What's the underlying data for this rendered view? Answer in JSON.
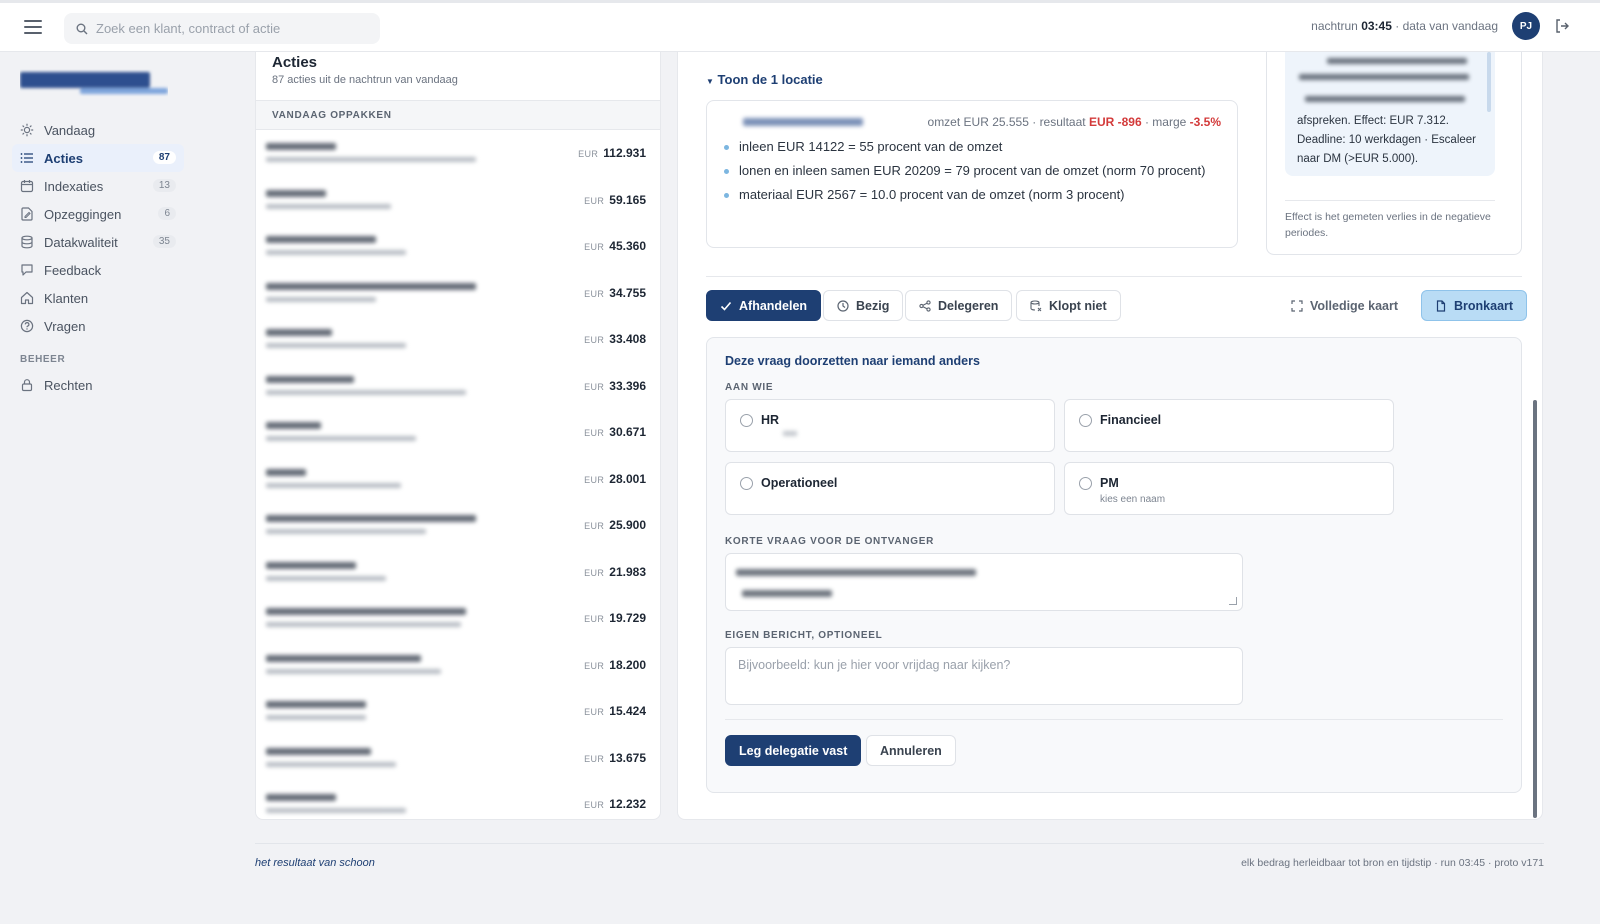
{
  "topbar": {
    "search_placeholder": "Zoek een klant, contract of actie",
    "run_prefix": "nachtrun",
    "run_time": "03:45",
    "run_suffix": "· data van vandaag",
    "avatar_initials": "PJ"
  },
  "sidebar": {
    "items": [
      {
        "label": "Vandaag",
        "icon": "sun-icon",
        "badge": ""
      },
      {
        "label": "Acties",
        "icon": "list-icon",
        "badge": "87"
      },
      {
        "label": "Indexaties",
        "icon": "calendar-icon",
        "badge": "13"
      },
      {
        "label": "Opzeggingen",
        "icon": "document-edit-icon",
        "badge": "6"
      },
      {
        "label": "Datakwaliteit",
        "icon": "database-icon",
        "badge": "35"
      },
      {
        "label": "Feedback",
        "icon": "chat-icon",
        "badge": ""
      },
      {
        "label": "Klanten",
        "icon": "home-icon",
        "badge": ""
      },
      {
        "label": "Vragen",
        "icon": "help-icon",
        "badge": ""
      }
    ],
    "section": "BEHEER",
    "admin_items": [
      {
        "label": "Rechten",
        "icon": "lock-icon"
      }
    ]
  },
  "actions": {
    "title": "Acties",
    "subtitle": "87 acties uit de nachtrun van vandaag",
    "section": "VANDAAG OPPAKKEN",
    "currency": "EUR",
    "rows": [
      {
        "amount": "112.931"
      },
      {
        "amount": "59.165"
      },
      {
        "amount": "45.360"
      },
      {
        "amount": "34.755"
      },
      {
        "amount": "33.408"
      },
      {
        "amount": "33.396"
      },
      {
        "amount": "30.671"
      },
      {
        "amount": "28.001"
      },
      {
        "amount": "25.900"
      },
      {
        "amount": "21.983"
      },
      {
        "amount": "19.729"
      },
      {
        "amount": "18.200"
      },
      {
        "amount": "15.424"
      },
      {
        "amount": "13.675"
      },
      {
        "amount": "12.232"
      }
    ]
  },
  "main": {
    "toggle": "Toon de 1 locatie",
    "location": {
      "metrics_a": "omzet EUR 25.555 · resultaat ",
      "resultaat": "EUR -896",
      "metrics_b": " · marge ",
      "marge": "-3.5%",
      "bullets": [
        "inleen EUR 14122 = 55 procent van de omzet",
        "lonen en inleen samen EUR 20209 = 79 procent van de omzet (norm 70 procent)",
        "materiaal EUR 2567 = 10.0 procent van de omzet (norm 3 procent)"
      ]
    },
    "side": {
      "text": "afspreken. Effect: EUR 7.312. Deadline: 10 werkdagen · Escaleer naar DM (>EUR 5.000).",
      "note": "Effect is het gemeten verlies in de negatieve periodes."
    },
    "buttons": {
      "afhandelen": "Afhandelen",
      "bezig": "Bezig",
      "delegeren": "Delegeren",
      "klopt_niet": "Klopt niet",
      "volledige_kaart": "Volledige kaart",
      "bronkaart": "Bronkaart"
    },
    "delegation": {
      "title": "Deze vraag doorzetten naar iemand anders",
      "to_label": "AAN WIE",
      "options": [
        {
          "name": "HR",
          "sub": ""
        },
        {
          "name": "Financieel",
          "sub": ""
        },
        {
          "name": "Operationeel",
          "sub": ""
        },
        {
          "name": "PM",
          "sub": "kies een naam"
        }
      ],
      "question_label": "KORTE VRAAG VOOR DE ONTVANGER",
      "message_label": "EIGEN BERICHT, OPTIONEEL",
      "message_placeholder": "Bijvoorbeeld: kun je hier voor vrijdag naar kijken?",
      "submit": "Leg delegatie vast",
      "cancel": "Annuleren"
    }
  },
  "footer": {
    "left": "het resultaat van schoon",
    "right": "elk bedrag herleidbaar tot bron en tijdstip · run 03:45 · proto v171"
  },
  "colors": {
    "brand": "#1e3f73",
    "negative": "#d33a3a",
    "accent_light": "#b9dcf5"
  }
}
